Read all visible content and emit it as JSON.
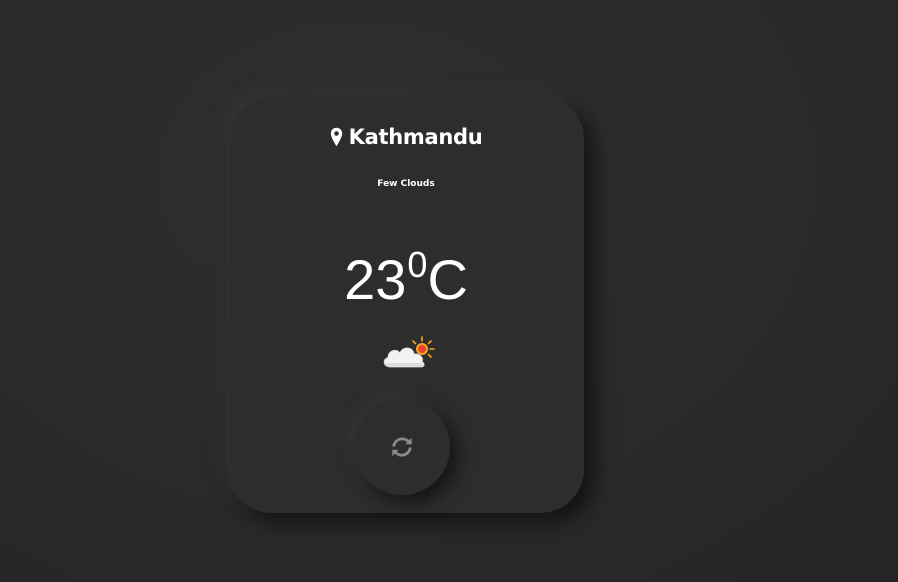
{
  "weather": {
    "city": "Kathmandu",
    "description": "Few Clouds",
    "temperature_value": "23",
    "temperature_degree": "0",
    "temperature_unit": "C",
    "condition_icon": "partly-cloudy-icon"
  },
  "icons": {
    "location": "map-pin-icon",
    "refresh": "refresh-icon"
  },
  "colors": {
    "background": "#2a2a2a",
    "card": "#2d2d2d",
    "text": "#ffffff",
    "icon_muted": "#8a8a8a",
    "sun": "#f5a623",
    "sun_core": "#e8452c"
  }
}
